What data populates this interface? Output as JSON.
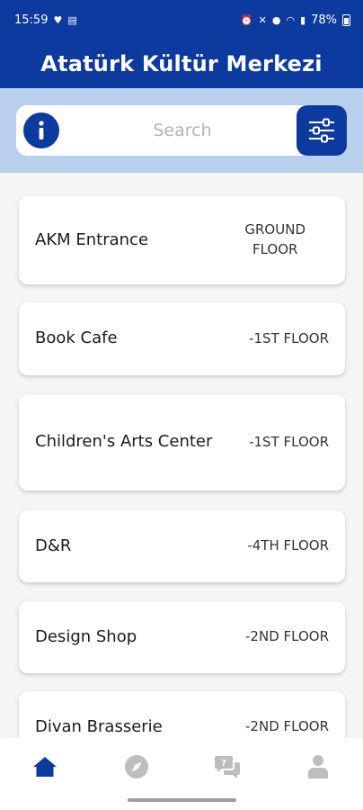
{
  "status_bar": {
    "time": "15:59",
    "battery": "78%"
  },
  "header": {
    "title": "Atatürk Kültür Merkezi"
  },
  "search": {
    "placeholder": "Search"
  },
  "locations": [
    {
      "name": "AKM Entrance",
      "floor": "GROUND\nFLOOR"
    },
    {
      "name": "Book Cafe",
      "floor": "-1ST FLOOR"
    },
    {
      "name": "Children's Arts Center",
      "floor": "-1ST FLOOR"
    },
    {
      "name": "D&R",
      "floor": "-4TH FLOOR"
    },
    {
      "name": "Design Shop",
      "floor": "-2ND FLOOR"
    },
    {
      "name": "Divan Brasserie",
      "floor": "-2ND FLOOR"
    }
  ],
  "bottom_nav": [
    {
      "icon": "home-icon",
      "active": true
    },
    {
      "icon": "compass-icon",
      "active": false
    },
    {
      "icon": "chat-help-icon",
      "active": false
    },
    {
      "icon": "profile-icon",
      "active": false
    }
  ],
  "colors": {
    "primary": "#0d3a9e",
    "search_band": "#b8d0ee",
    "inactive_icon": "#bdbdbd"
  }
}
